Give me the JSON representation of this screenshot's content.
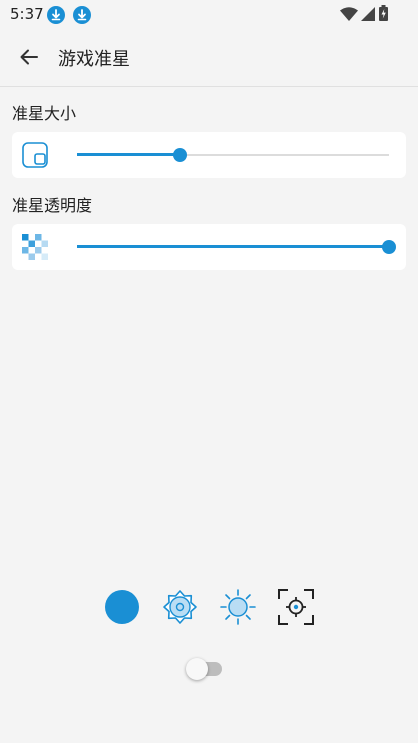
{
  "status_bar": {
    "time": "5:37",
    "left_icons": [
      "download-icon",
      "download-icon"
    ],
    "right_icons": [
      "wifi-icon",
      "signal-icon",
      "battery-icon"
    ]
  },
  "app_bar": {
    "back_icon": "arrow-left-icon",
    "title": "游戏准星"
  },
  "settings": {
    "size": {
      "label": "准星大小",
      "icon": "resize-square-icon",
      "value": 0.33
    },
    "opacity": {
      "label": "准星透明度",
      "icon": "checkerboard-transparency-icon",
      "value": 1.0
    }
  },
  "crosshair_options": [
    {
      "icon": "filled-circle-icon",
      "selected": true
    },
    {
      "icon": "gear-circle-icon",
      "selected": false
    },
    {
      "icon": "sun-circle-icon",
      "selected": false
    },
    {
      "icon": "target-crosshair-icon",
      "selected": false
    }
  ],
  "toggle": {
    "on": false
  },
  "colors": {
    "accent": "#1a8fd4",
    "background": "#f4f4f4",
    "card": "#ffffff",
    "text": "#222222"
  }
}
